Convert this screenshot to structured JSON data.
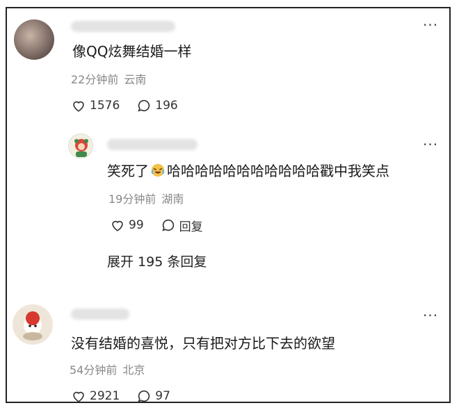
{
  "comments": [
    {
      "text": "像QQ炫舞结婚一样",
      "time": "22分钟前",
      "location": "云南",
      "likes": "1576",
      "replies": "196"
    },
    {
      "text_prefix": "笑死了",
      "emoji": "crying-laughing-emoji",
      "text_suffix": "哈哈哈哈哈哈哈哈哈哈哈戳中我笑点",
      "time": "19分钟前",
      "location": "湖南",
      "likes": "99",
      "reply_label": "回复",
      "expand_label": "展开 195 条回复"
    },
    {
      "text": "没有结婚的喜悦，只有把对方比下去的欲望",
      "time": "54分钟前",
      "location": "北京",
      "likes": "2921",
      "replies": "97"
    }
  ],
  "more_glyph": "···"
}
